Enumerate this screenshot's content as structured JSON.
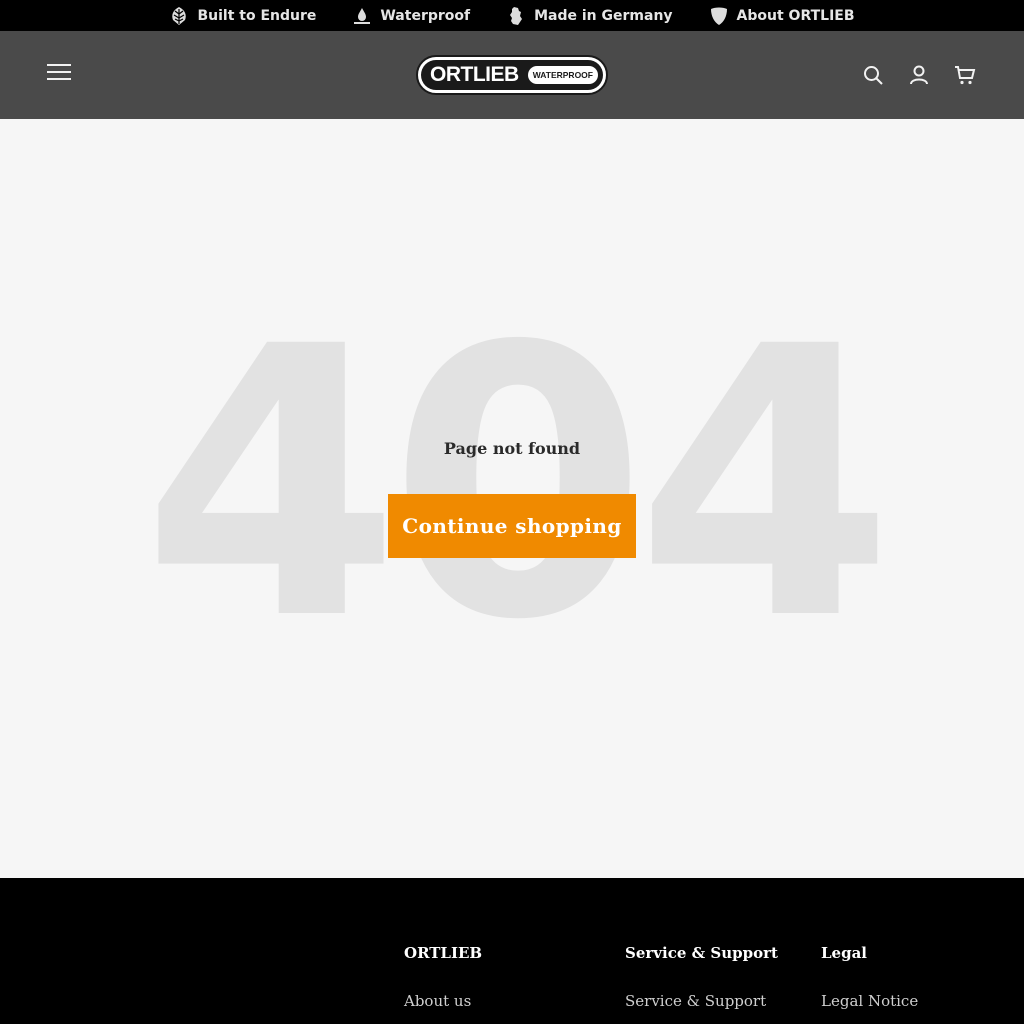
{
  "topbar": {
    "items": [
      {
        "label": "Built to Endure",
        "icon": "leaf-icon"
      },
      {
        "label": "Waterproof",
        "icon": "water-drop-icon"
      },
      {
        "label": "Made in Germany",
        "icon": "germany-map-icon"
      },
      {
        "label": "About ORTLIEB",
        "icon": "shield-icon"
      }
    ]
  },
  "header": {
    "logo": {
      "word": "ORTLIEB",
      "tag": "WATERPROOF"
    },
    "icons": [
      "menu-icon",
      "search-icon",
      "account-icon",
      "cart-icon"
    ]
  },
  "main": {
    "error_code": "404",
    "message": "Page not found",
    "cta_label": "Continue shopping"
  },
  "footer": {
    "columns": [
      {
        "title": "ORTLIEB",
        "links": [
          "About us"
        ]
      },
      {
        "title": "Service & Support",
        "links": [
          "Service & Support"
        ]
      },
      {
        "title": "Legal",
        "links": [
          "Legal Notice"
        ]
      }
    ]
  },
  "colors": {
    "accent": "#f08a00",
    "header_bg": "#4a4a4a",
    "topbar_bg": "#000000",
    "page_bg": "#f6f6f6",
    "error_code": "#e2e2e2"
  }
}
